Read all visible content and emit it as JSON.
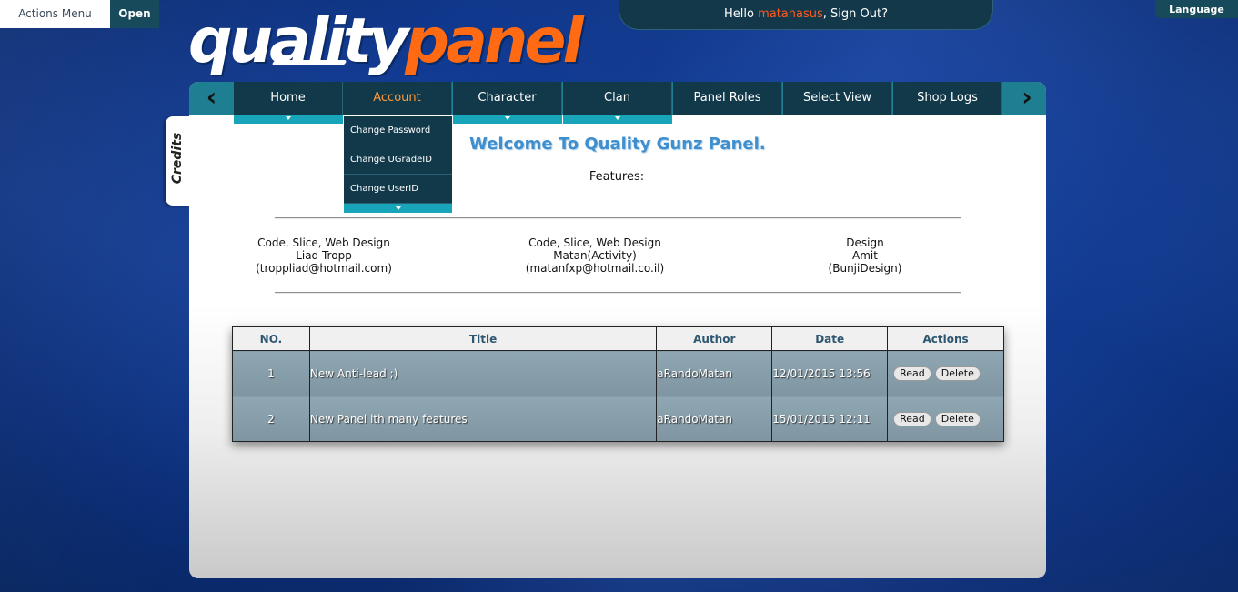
{
  "actions_menu": {
    "label": "Actions Menu",
    "open_label": "Open"
  },
  "logo": {
    "part1": "quality",
    "part2": "panel"
  },
  "header": {
    "hello": "Hello ",
    "username": "matanasus",
    "signout": ", Sign Out?"
  },
  "language": {
    "label": "Language"
  },
  "nav": {
    "left_arrow": "‹",
    "right_arrow": "›",
    "items": [
      {
        "label": "Home",
        "active": false,
        "has_dropdown": true
      },
      {
        "label": "Account",
        "active": true,
        "has_dropdown": false
      },
      {
        "label": "Character",
        "active": false,
        "has_dropdown": true
      },
      {
        "label": "Clan",
        "active": false,
        "has_dropdown": true
      },
      {
        "label": "Panel Roles",
        "active": false,
        "has_dropdown": false
      },
      {
        "label": "Select View",
        "active": false,
        "has_dropdown": false
      },
      {
        "label": "Shop Logs",
        "active": false,
        "has_dropdown": false
      }
    ]
  },
  "account_submenu": {
    "items": [
      "Change Password",
      "Change UGradeID",
      "Change UserID"
    ]
  },
  "credits_tab": {
    "label": "Credits"
  },
  "main": {
    "welcome": "Welcome To Quality Gunz Panel.",
    "features": "Features:"
  },
  "credits": [
    {
      "role": "Code, Slice, Web Design",
      "name": "Liad Tropp",
      "contact": "(troppliad@hotmail.com)"
    },
    {
      "role": "Code, Slice, Web Design",
      "name": "Matan(Activity)",
      "contact": "(matanfxp@hotmail.co.il)"
    },
    {
      "role": "Design",
      "name": "Amit",
      "contact": "(BunjiDesign)"
    }
  ],
  "news_table": {
    "headers": [
      "NO.",
      "Title",
      "Author",
      "Date",
      "Actions"
    ],
    "rows": [
      {
        "no": "1",
        "title": "New Anti-lead ;)",
        "author": "aRandoMatan",
        "date": "12/01/2015 13:56",
        "read": "Read",
        "delete": "Delete"
      },
      {
        "no": "2",
        "title": "New Panel ith many features",
        "author": "aRandoMatan",
        "date": "15/01/2015 12:11",
        "read": "Read",
        "delete": "Delete"
      }
    ]
  },
  "colors": {
    "background": "#123f9e",
    "nav_bg": "#12394a",
    "nav_accent": "#19a5b9",
    "active_nav": "#ff9a3a",
    "username": "#ff5a1f",
    "welcome": "#3f8fcf",
    "row_bg": "#8fa7b2"
  }
}
